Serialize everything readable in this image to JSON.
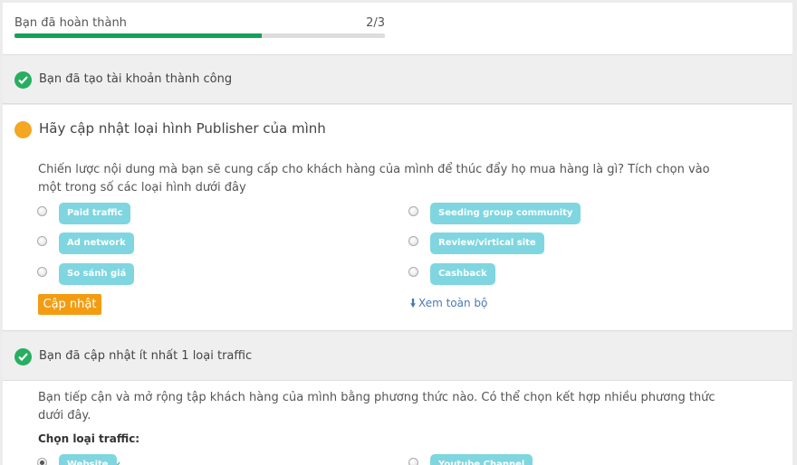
{
  "progress": {
    "label": "Bạn đã hoàn thành",
    "count": "2/3",
    "fraction": 0.667,
    "color": "#13a15a"
  },
  "step1": {
    "title": "Bạn đã tạo tài khoản thành công",
    "status": "done"
  },
  "step2": {
    "title": "Hãy cập nhật loại hình Publisher của mình",
    "status": "pending",
    "description": "Chiến lược nội dung mà bạn sẽ cung cấp cho khách hàng của mình để thúc đẩy họ mua hàng là gì? Tích chọn vào một trong số các loại hình dưới đây",
    "options_left": [
      "Paid traffic",
      "Ad network",
      "So sánh giá"
    ],
    "options_right": [
      "Seeding group community",
      "Review/virtical site",
      "Cashback"
    ],
    "update_button": "Cập nhật",
    "view_all": "Xem toàn bộ"
  },
  "step3": {
    "title": "Bạn đã cập nhật ít nhất 1 loại traffic",
    "status": "done",
    "description": "Bạn tiếp cận và mở rộng tập khách hàng của mình bằng phương thức nào. Có thể chọn kết hợp nhiều phương thức dưới đây.",
    "choose_label": "Chọn loại traffic:",
    "options": [
      "Website",
      "Youtube Channel"
    ],
    "selected": "Website"
  },
  "colors": {
    "accent_orange": "#f39c12",
    "check_green": "#27ae60",
    "tag_cyan": "#7fd6e0",
    "link_blue": "#4a7ab5"
  },
  "icons": {
    "done": "check-circle-icon",
    "pending": "orange-dot-icon",
    "view_all": "arrow-down-icon"
  }
}
